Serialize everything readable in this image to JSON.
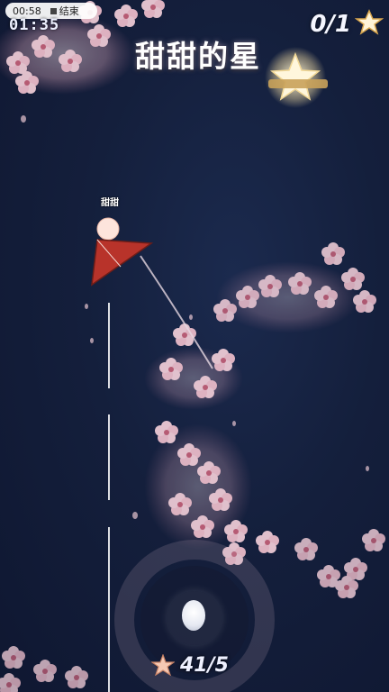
{
  "recording": {
    "elapsed": "00:58",
    "end_label": "结束"
  },
  "hud": {
    "timer": "01:35",
    "goal_counter": "0/1",
    "title": "甜甜的星",
    "score": "41/5"
  },
  "player": {
    "name": "甜甜"
  },
  "colors": {
    "background": "#141f3c",
    "blossom": "#f4c9d4",
    "kite": "#b8332a",
    "star": "#fff2c8",
    "ribbon": "#c9a25a"
  },
  "icons": {
    "goal_star": "star-icon",
    "score_star": "star-icon",
    "stop": "stop-icon"
  }
}
